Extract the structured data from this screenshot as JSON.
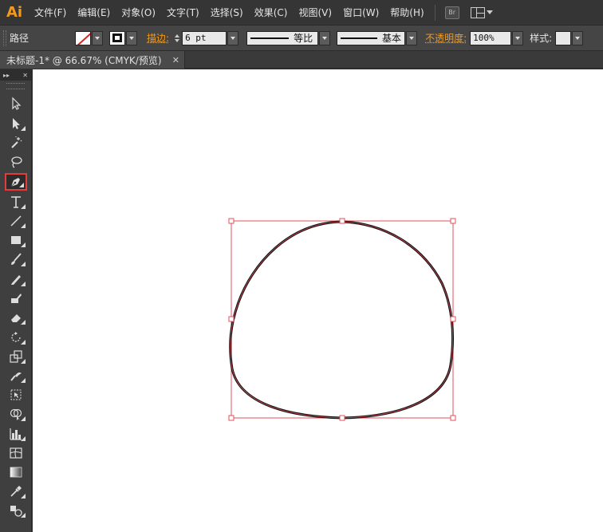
{
  "app": {
    "logo": "Ai"
  },
  "menu": {
    "items": [
      "文件(F)",
      "编辑(E)",
      "对象(O)",
      "文字(T)",
      "选择(S)",
      "效果(C)",
      "视图(V)",
      "窗口(W)",
      "帮助(H)"
    ],
    "bridge_label": "Br"
  },
  "control": {
    "object_type": "路径",
    "stroke_label": "描边:",
    "stroke_weight": "6 pt",
    "variable_width": "等比",
    "brush_definition": "基本",
    "opacity_label": "不透明度:",
    "opacity_value": "100%",
    "style_label": "样式:"
  },
  "document": {
    "tab_title": "未标题-1* @ 66.67% (CMYK/预览)",
    "close_glyph": "✕"
  },
  "tools": {
    "header_expand": "▸▸",
    "header_close": "✕",
    "items": [
      "selection-tool",
      "direct-selection-tool",
      "magic-wand-tool",
      "lasso-tool",
      "pen-tool",
      "type-tool",
      "line-segment-tool",
      "rectangle-tool",
      "paintbrush-tool",
      "pencil-tool",
      "blob-brush-tool",
      "eraser-tool",
      "rotate-tool",
      "scale-tool",
      "warp-tool",
      "free-transform-tool",
      "shape-builder-tool",
      "column-graph-tool",
      "mesh-tool",
      "gradient-tool",
      "eyedropper-tool",
      "blend-tool"
    ],
    "selected": "pen-tool"
  },
  "colors": {
    "accent": "#f39a1e",
    "selection": "#e53b3b",
    "canvas": "#ffffff",
    "path_stroke": "#111111",
    "bounding_box": "#e0505a"
  }
}
